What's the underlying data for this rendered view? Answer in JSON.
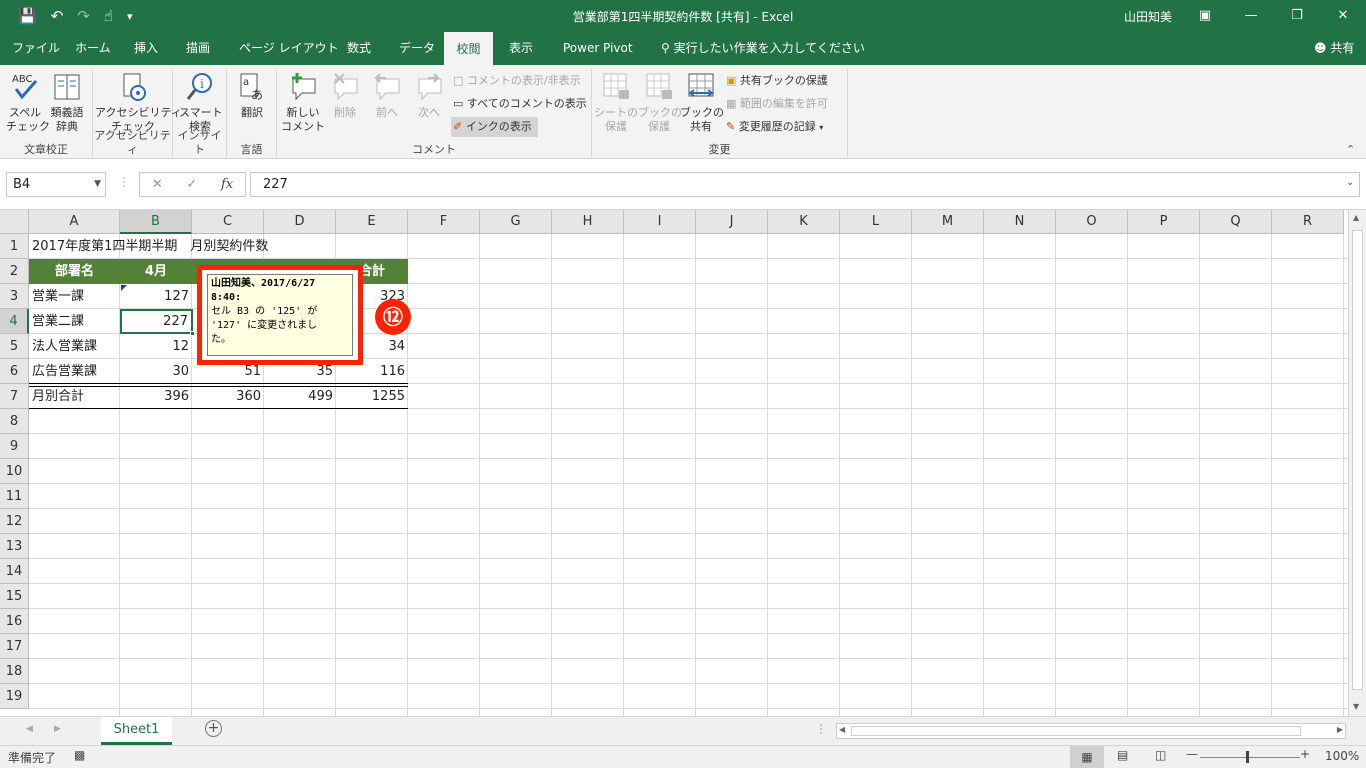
{
  "title_bar": {
    "title": "営業部第1四半期契約件数 [共有] - Excel",
    "user": "山田知美",
    "qat_icons": [
      "save-icon",
      "undo-icon",
      "redo-icon",
      "touch-mode-icon",
      "customize-icon"
    ]
  },
  "tabs": [
    {
      "label": "ファイル"
    },
    {
      "label": "ホーム"
    },
    {
      "label": "挿入"
    },
    {
      "label": "描画"
    },
    {
      "label": "ページ レイアウト"
    },
    {
      "label": "数式"
    },
    {
      "label": "データ"
    },
    {
      "label": "校閲",
      "active": true
    },
    {
      "label": "表示"
    },
    {
      "label": "Power Pivot"
    }
  ],
  "tell_me": "実行したい作業を入力してください",
  "share_label": "共有",
  "ribbon": {
    "proofing": {
      "group": "文章校正",
      "spell": "スペル\nチェック",
      "thesaurus": "類義語\n辞典"
    },
    "accessibility": {
      "group": "アクセシビリティ",
      "check": "アクセシビリティ\nチェック"
    },
    "insights": {
      "group": "インサイト",
      "smart": "スマート\n検索"
    },
    "language": {
      "group": "言語",
      "translate": "翻訳"
    },
    "comments": {
      "group": "コメント",
      "new": "新しい\nコメント",
      "delete": "削除",
      "prev": "前へ",
      "next": "次へ",
      "show_hide": "コメントの表示/非表示",
      "show_all": "すべてのコメントの表示",
      "show_ink": "インクの表示"
    },
    "changes": {
      "group": "変更",
      "protect_sheet": "シートの\n保護",
      "protect_book": "ブックの\n保護",
      "share_book": "ブックの\n共有",
      "protect_shared": "共有ブックの保護",
      "allow_edit": "範囲の編集を許可",
      "track": "変更履歴の記録"
    }
  },
  "formula_bar": {
    "name_box": "B4",
    "value": "227"
  },
  "columns": [
    "A",
    "B",
    "C",
    "D",
    "E",
    "F",
    "G",
    "H",
    "I",
    "J",
    "K",
    "L",
    "M",
    "N",
    "O",
    "P",
    "Q",
    "R"
  ],
  "rows": [
    "1",
    "2",
    "3",
    "4",
    "5",
    "6",
    "7",
    "8",
    "9",
    "10",
    "11",
    "12",
    "13",
    "14",
    "15",
    "16",
    "17",
    "18",
    "19"
  ],
  "sheet": {
    "a1": "2017年度第1四半期半期　月別契約件数",
    "header": {
      "a": "部署名",
      "b": "4月",
      "e": "合計"
    },
    "rows": [
      {
        "a": "営業一課",
        "b": "127",
        "e": "323"
      },
      {
        "a": "営業二課",
        "b": "227"
      },
      {
        "a": "法人営業課",
        "b": "12",
        "e": "34"
      },
      {
        "a": "広告営業課",
        "b": "30",
        "c": "51",
        "d": "35",
        "e": "116"
      },
      {
        "a": "月別合計",
        "b": "396",
        "c": "360",
        "d": "499",
        "e": "1255"
      }
    ]
  },
  "comment": {
    "author": "山田知美、2017/6/27",
    "time": "8:40:",
    "line1": "セル B3 の '125' が",
    "line2": "'127' に変更されまし",
    "line3": "た。"
  },
  "callout": "⑫",
  "sheet_tabs": [
    {
      "label": "Sheet1"
    }
  ],
  "status": {
    "ready": "準備完了",
    "zoom": "100%"
  }
}
